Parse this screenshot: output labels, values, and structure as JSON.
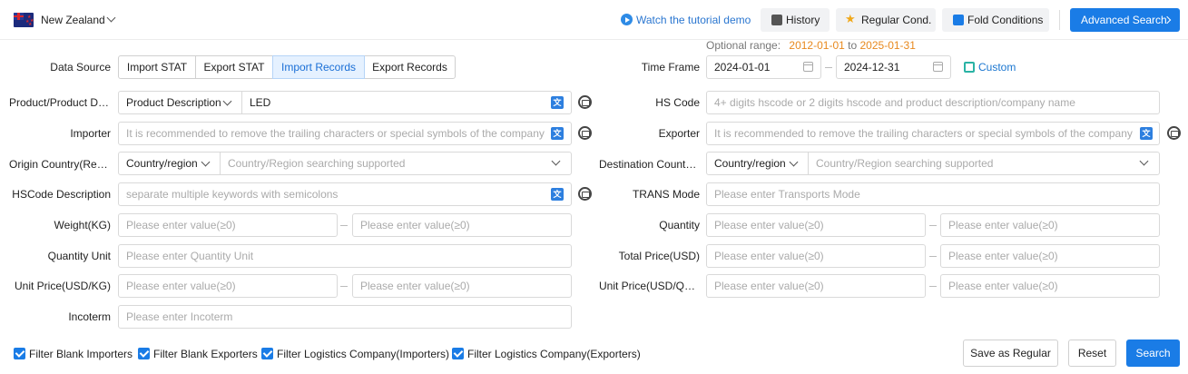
{
  "header": {
    "country": "New Zealand",
    "tutorial": "Watch the tutorial demo",
    "history": "History",
    "regular_cond": "Regular Cond.",
    "fold": "Fold Conditions",
    "advanced": "Advanced Search"
  },
  "optional_range": {
    "label": "Optional range:",
    "start": "2012-01-01",
    "to": "to",
    "end": "2025-01-31"
  },
  "data_source": {
    "label": "Data Source",
    "options": [
      "Import STAT",
      "Export STAT",
      "Import Records",
      "Export Records"
    ],
    "selected": "Import Records"
  },
  "time_frame": {
    "label": "Time Frame",
    "start": "2024-01-01",
    "end": "2024-12-31",
    "custom": "Custom"
  },
  "product": {
    "label": "Product/Product Description",
    "selector": "Product Description",
    "value": "LED"
  },
  "hs_code": {
    "label": "HS Code",
    "placeholder": "4+ digits hscode or 2 digits hscode and product description/company name"
  },
  "importer": {
    "label": "Importer",
    "placeholder": "It is recommended to remove the trailing characters or special symbols of the company"
  },
  "exporter": {
    "label": "Exporter",
    "placeholder": "It is recommended to remove the trailing characters or special symbols of the company"
  },
  "origin": {
    "label": "Origin Country(Region)",
    "selector": "Country/region",
    "placeholder": "Country/Region searching supported"
  },
  "destination": {
    "label": "Destination Country(Region)",
    "selector": "Country/region",
    "placeholder": "Country/Region searching supported"
  },
  "hscode_desc": {
    "label": "HSCode Description",
    "placeholder": "separate multiple keywords with semicolons"
  },
  "trans_mode": {
    "label": "TRANS Mode",
    "placeholder": "Please enter Transports Mode"
  },
  "weight": {
    "label": "Weight(KG)",
    "placeholder": "Please enter value(≥0)"
  },
  "quantity": {
    "label": "Quantity",
    "placeholder": "Please enter value(≥0)"
  },
  "quantity_unit": {
    "label": "Quantity Unit",
    "placeholder": "Please enter Quantity Unit"
  },
  "total_price": {
    "label": "Total Price(USD)",
    "placeholder": "Please enter value(≥0)"
  },
  "unit_price_kg": {
    "label": "Unit Price(USD/KG)",
    "placeholder": "Please enter value(≥0)"
  },
  "unit_price_qty": {
    "label": "Unit Price(USD/QTY)",
    "placeholder": "Please enter value(≥0)"
  },
  "incoterm": {
    "label": "Incoterm",
    "placeholder": "Please enter Incoterm"
  },
  "range_sep": "—",
  "filters": [
    "Filter Blank Importers",
    "Filter Blank Exporters",
    "Filter Logistics Company(Importers)",
    "Filter Logistics Company(Exporters)"
  ],
  "actions": {
    "save_regular": "Save as Regular",
    "reset": "Reset",
    "search": "Search"
  },
  "colors": {
    "primary": "#1a7ce6",
    "orange": "#e8891e",
    "link": "#2a76d0"
  }
}
